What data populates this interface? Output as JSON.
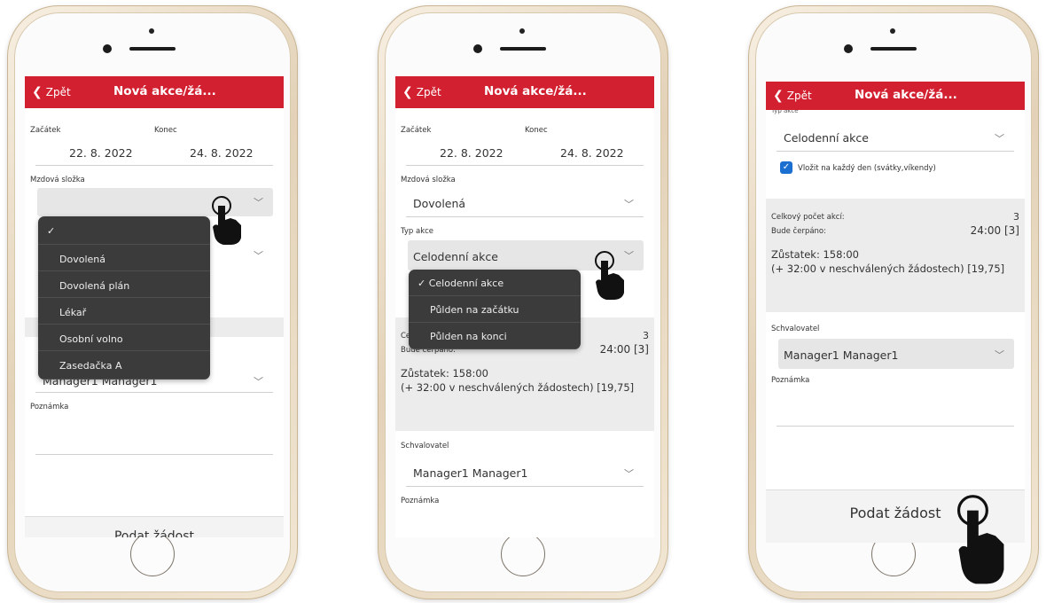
{
  "header": {
    "back_label": "Zpět",
    "title": "Nová akce/žá..."
  },
  "labels": {
    "start": "Začátek",
    "end": "Konec",
    "wage_component": "Mzdová složka",
    "action_type": "Typ akce",
    "approver": "Schvalovatel",
    "note": "Poznámka",
    "total_actions": "Celkový počet akcí:",
    "will_draw": "Bude čerpáno:"
  },
  "values": {
    "start_date": "22. 8. 2022",
    "end_date": "24. 8. 2022",
    "wage_selected": "Dovolená",
    "action_type_selected": "Celodenní akce",
    "approver_selected": "Manager1 Manager1",
    "total_actions_count": "3",
    "will_draw_value": "24:00 [3]",
    "balance_line1": "Zůstatek: 158:00",
    "balance_line2": "(+ 32:00 v neschválených žádostech) [19,75]",
    "checkbox_label": "Vložit na každý den (svátky,víkendy)",
    "typ_akce_partial": "Typ akce"
  },
  "dropdown_wage": {
    "check": "✓",
    "options": [
      "Dovolená",
      "Dovolená plán",
      "Lékař",
      "Osobní volno",
      "Zasedačka A"
    ]
  },
  "dropdown_type": {
    "options": [
      "✓ Celodenní akce",
      "Půlden na začátku",
      "Půlden na konci"
    ]
  },
  "submit_label": "Podat žádost",
  "submit_label_partial": "Podat žádost",
  "icons": {
    "back": "chevron-left-icon",
    "select": "chevron-down-icon",
    "hand": "hand-pointer-icon",
    "check": "checkbox-checked-icon"
  },
  "colors": {
    "accent": "#d32030",
    "dropdown_bg": "#3b3b3b",
    "checkbox": "#1a6fd0"
  }
}
